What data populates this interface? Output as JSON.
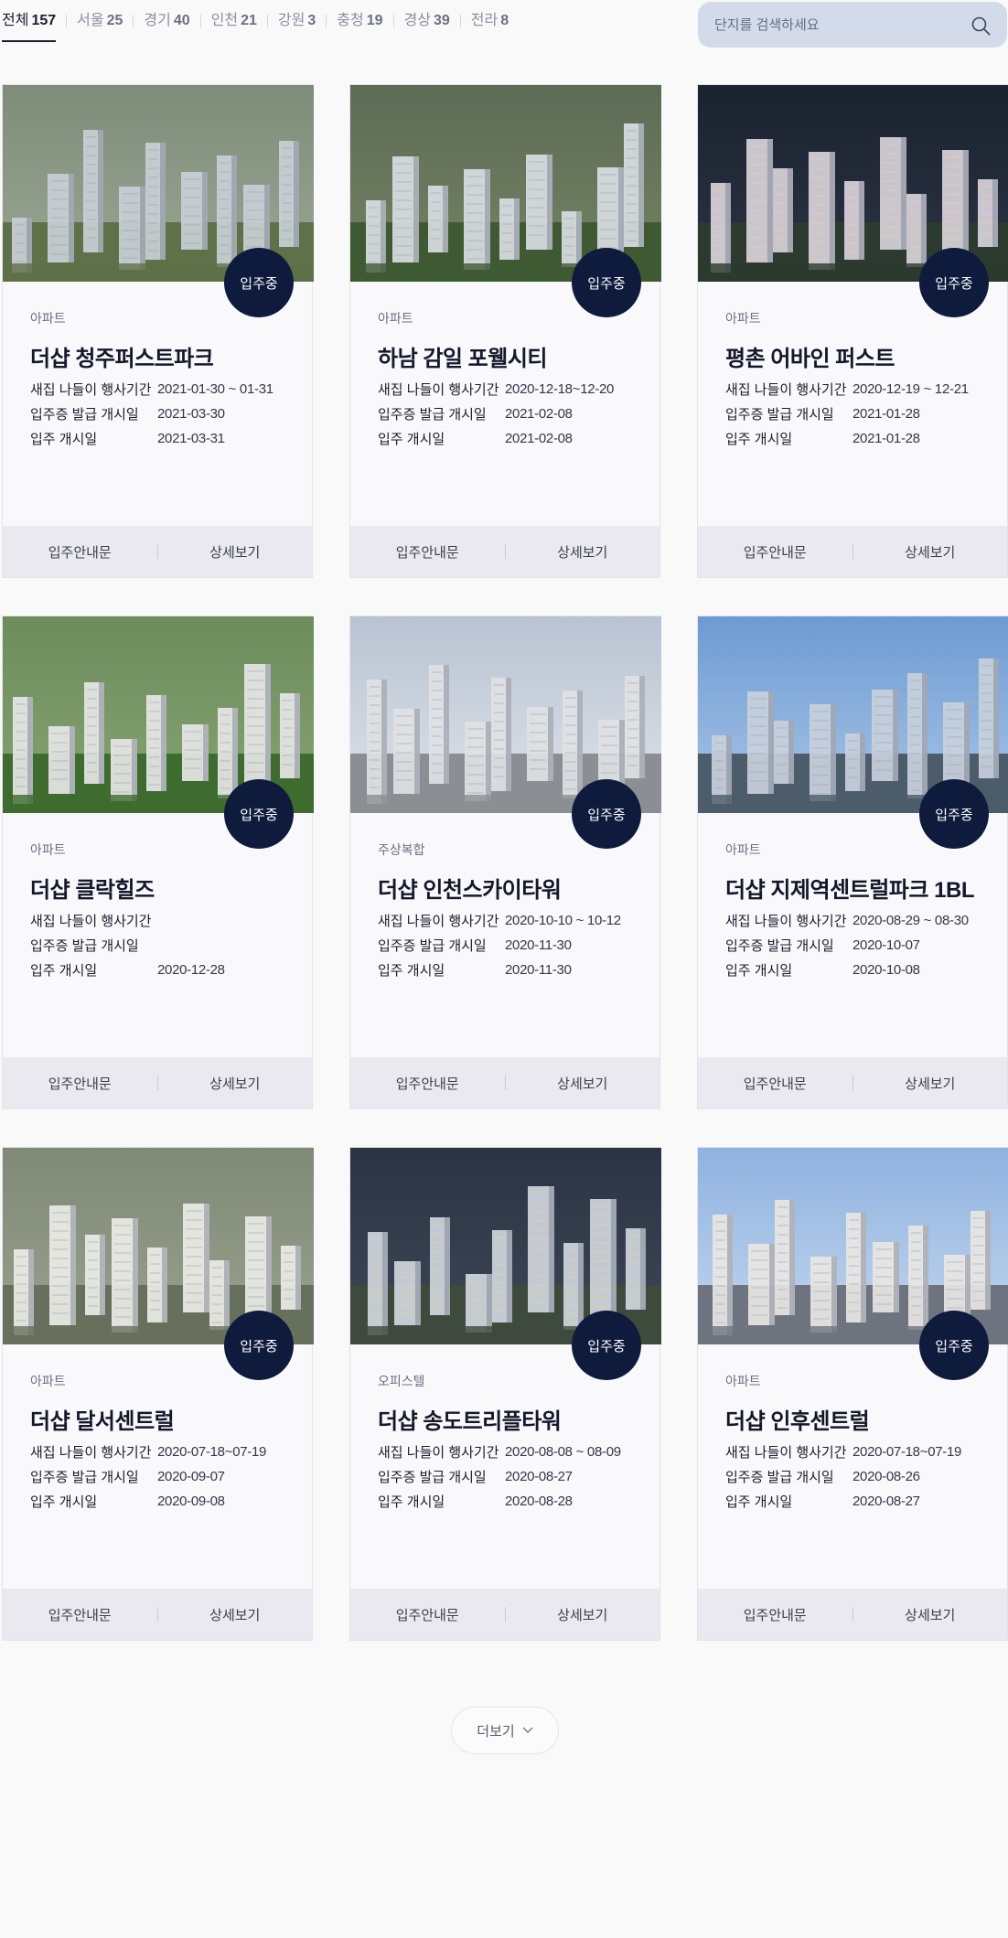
{
  "filters": [
    {
      "label": "전체",
      "count": "157"
    },
    {
      "label": "서울",
      "count": "25"
    },
    {
      "label": "경기",
      "count": "40"
    },
    {
      "label": "인천",
      "count": "21"
    },
    {
      "label": "강원",
      "count": "3"
    },
    {
      "label": "충청",
      "count": "19"
    },
    {
      "label": "경상",
      "count": "39"
    },
    {
      "label": "전라",
      "count": "8"
    }
  ],
  "search": {
    "placeholder": "단지를 검색하세요"
  },
  "labels": {
    "badge": "입주중",
    "row1": "새집 나들이 행사기간",
    "row2": "입주증 발급 개시일",
    "row3": "입주 개시일",
    "guide": "입주안내문",
    "detail": "상세보기",
    "more": "더보기"
  },
  "cards": [
    {
      "category": "아파트",
      "title": "더샵 청주퍼스트파크",
      "event": "2021-01-30 ~ 01-31",
      "issue": "2021-03-30",
      "move_in": "2021-03-31"
    },
    {
      "category": "아파트",
      "title": "하남 감일 포웰시티",
      "event": "2020-12-18~12-20",
      "issue": "2021-02-08",
      "move_in": "2021-02-08"
    },
    {
      "category": "아파트",
      "title": "평촌 어바인 퍼스트",
      "event": "2020-12-19 ~ 12-21",
      "issue": "2021-01-28",
      "move_in": "2021-01-28"
    },
    {
      "category": "아파트",
      "title": "더샵 클락힐즈",
      "event": "",
      "issue": "",
      "move_in": "2020-12-28"
    },
    {
      "category": "주상복합",
      "title": "더샵 인천스카이타워",
      "event": "2020-10-10 ~ 10-12",
      "issue": "2020-11-30",
      "move_in": "2020-11-30"
    },
    {
      "category": "아파트",
      "title": "더샵 지제역센트럴파크 1BL",
      "event": "2020-08-29 ~ 08-30",
      "issue": "2020-10-07",
      "move_in": "2020-10-08"
    },
    {
      "category": "아파트",
      "title": "더샵 달서센트럴",
      "event": "2020-07-18~07-19",
      "issue": "2020-09-07",
      "move_in": "2020-09-08"
    },
    {
      "category": "오피스텔",
      "title": "더샵 송도트리플타워",
      "event": "2020-08-08 ~ 08-09",
      "issue": "2020-08-27",
      "move_in": "2020-08-28"
    },
    {
      "category": "아파트",
      "title": "더샵 인후센트럴",
      "event": "2020-07-18~07-19",
      "issue": "2020-08-26",
      "move_in": "2020-08-27"
    }
  ],
  "icons": {
    "search": "search-icon",
    "more": "chevron-down-icon"
  },
  "colors": {
    "badge": "#0f1b3d",
    "search_bg": "#d3dbeb",
    "footer_bg": "#e9e9ef"
  }
}
